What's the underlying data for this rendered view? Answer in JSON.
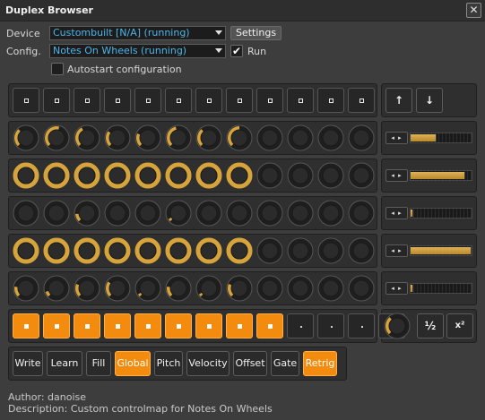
{
  "window": {
    "title": "Duplex Browser",
    "close_glyph": "✕"
  },
  "device": {
    "label": "Device",
    "value": "Custombuilt [N/A] (running)",
    "settings_label": "Settings"
  },
  "config": {
    "label": "Config.",
    "value": "Notes On Wheels (running)",
    "run_label": "Run",
    "run_checked": true
  },
  "autostart": {
    "label": "Autostart configuration",
    "checked": false
  },
  "grid": {
    "top_buttons_count": 12,
    "nav": {
      "up_glyph": "↑",
      "down_glyph": "↓"
    },
    "knob_rows": [
      {
        "row": 1,
        "type": "arc",
        "values": [
          0.35,
          0.55,
          0.4,
          0.3,
          0.25,
          0.45,
          0.35,
          0.5,
          0,
          0,
          0,
          0
        ],
        "slider": 0.42
      },
      {
        "row": 2,
        "type": "ring",
        "values": [
          0.8,
          1,
          1,
          1,
          0.75,
          1,
          1,
          1,
          0,
          0,
          0,
          0
        ],
        "slider": 0.9
      },
      {
        "row": 3,
        "type": "tick",
        "values": [
          0,
          0,
          0.15,
          0,
          0,
          0.05,
          0,
          0,
          0,
          0,
          0,
          0
        ],
        "slider": 0.05
      },
      {
        "row": 4,
        "type": "ring",
        "values": [
          1,
          1,
          1,
          1,
          1,
          1,
          1,
          1,
          0,
          0,
          0,
          0
        ],
        "slider": 1
      },
      {
        "row": 5,
        "type": "arc",
        "values": [
          0.2,
          0.1,
          0.25,
          0.3,
          0.05,
          0.2,
          0.05,
          0.25,
          0,
          0,
          0,
          0
        ],
        "slider": 0.05
      }
    ],
    "spinner_glyph": "◂ ▸",
    "bottom_pads": [
      true,
      true,
      true,
      true,
      true,
      true,
      true,
      true,
      true,
      false,
      false,
      false,
      false
    ],
    "bottom_knob_value": 0.35,
    "half_label": "½",
    "double_label": "x²"
  },
  "modes": [
    {
      "label": "Write",
      "active": false
    },
    {
      "label": "Learn",
      "active": false
    },
    {
      "label": "Fill",
      "active": false
    },
    {
      "label": "Global",
      "active": true
    },
    {
      "label": "Pitch",
      "active": false
    },
    {
      "label": "Velocity",
      "active": false
    },
    {
      "label": "Offset",
      "active": false
    },
    {
      "label": "Gate",
      "active": false
    },
    {
      "label": "Retrig",
      "active": true
    }
  ],
  "footer": {
    "author": "Author: danoise",
    "description": "Description: Custom controlmap for Notes On Wheels"
  },
  "colors": {
    "accent": "#f28b0e",
    "knob_fill": "#d7a43c",
    "link": "#4fb4ea"
  }
}
